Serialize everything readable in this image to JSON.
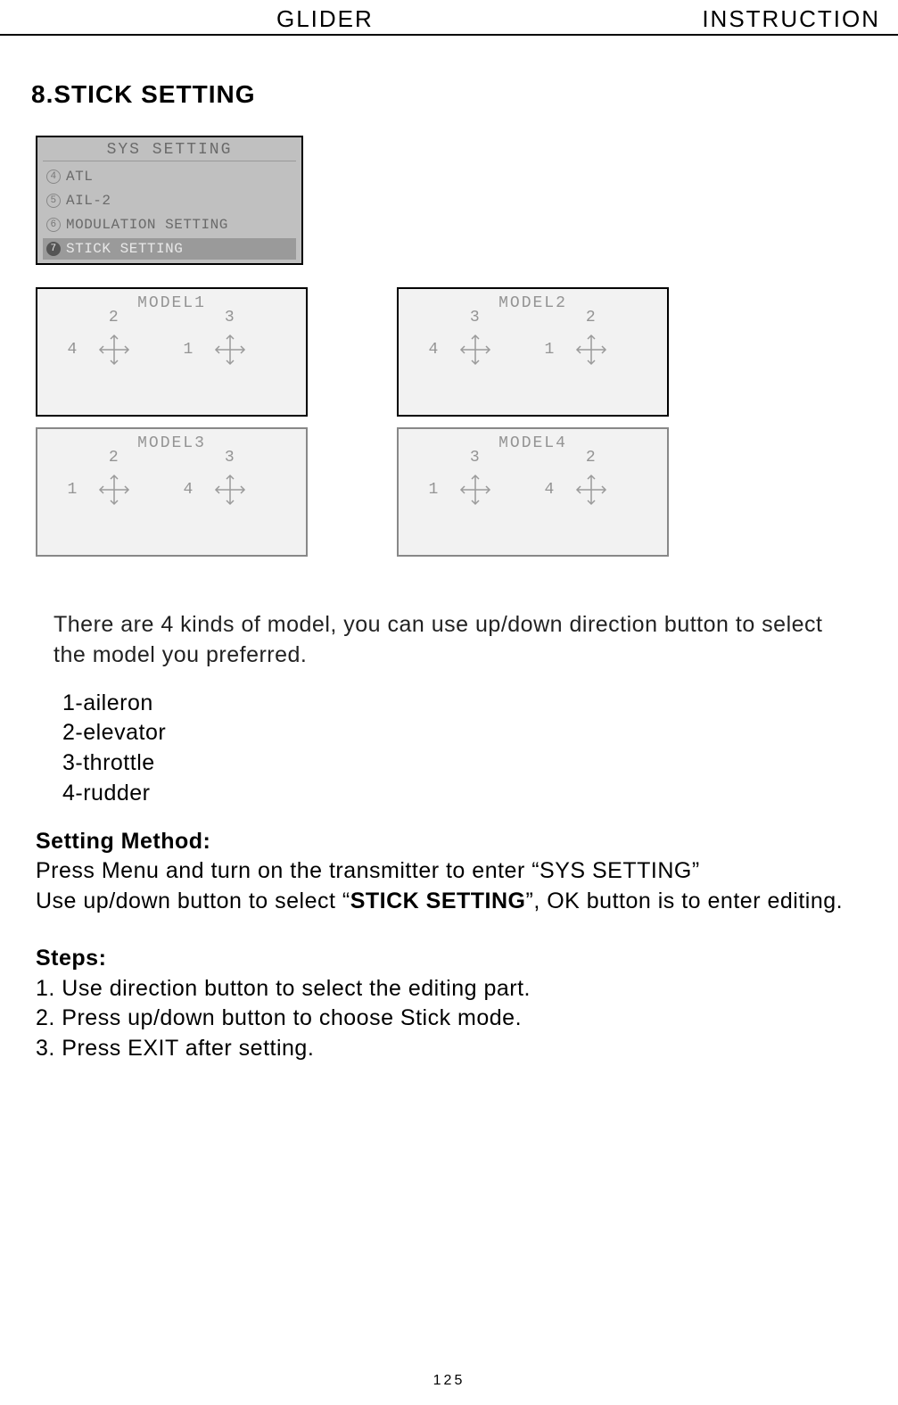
{
  "header": {
    "left": "GLIDER",
    "right": "INSTRUCTION"
  },
  "section_title": "8.STICK SETTING",
  "lcd_menu": {
    "title": "SYS SETTING",
    "items": [
      {
        "num": "4",
        "label": "ATL",
        "selected": false
      },
      {
        "num": "5",
        "label": "AIL-2",
        "selected": false
      },
      {
        "num": "6",
        "label": "MODULATION SETTING",
        "selected": false
      },
      {
        "num": "7",
        "label": "STICK SETTING",
        "selected": true
      }
    ]
  },
  "models": [
    {
      "title": "MODEL1",
      "left": {
        "top": "2",
        "side": "4"
      },
      "right": {
        "top": "3",
        "side": "1"
      }
    },
    {
      "title": "MODEL2",
      "left": {
        "top": "3",
        "side": "4"
      },
      "right": {
        "top": "2",
        "side": "1"
      }
    },
    {
      "title": "MODEL3",
      "left": {
        "top": "2",
        "side": "1"
      },
      "right": {
        "top": "3",
        "side": "4"
      }
    },
    {
      "title": "MODEL4",
      "left": {
        "top": "3",
        "side": "1"
      },
      "right": {
        "top": "2",
        "side": "4"
      }
    }
  ],
  "paragraph": "There are 4 kinds of model, you can use up/down direction button to select the model you preferred.",
  "legend": [
    "1-aileron",
    "2-elevator",
    "3-throttle",
    "4-rudder"
  ],
  "method": {
    "label": "Setting Method:",
    "line1_a": "Press Menu and turn on the transmitter to enter “SYS SETTING”",
    "line2_a": "Use up/down button to select “",
    "line2_bold": "STICK SETTING",
    "line2_b": "”, OK button is to enter editing."
  },
  "steps": {
    "label": "Steps:",
    "items": [
      "1. Use direction button to select the editing part.",
      "2. Press up/down button to choose Stick mode.",
      "3. Press EXIT after setting."
    ]
  },
  "page_number": "125"
}
